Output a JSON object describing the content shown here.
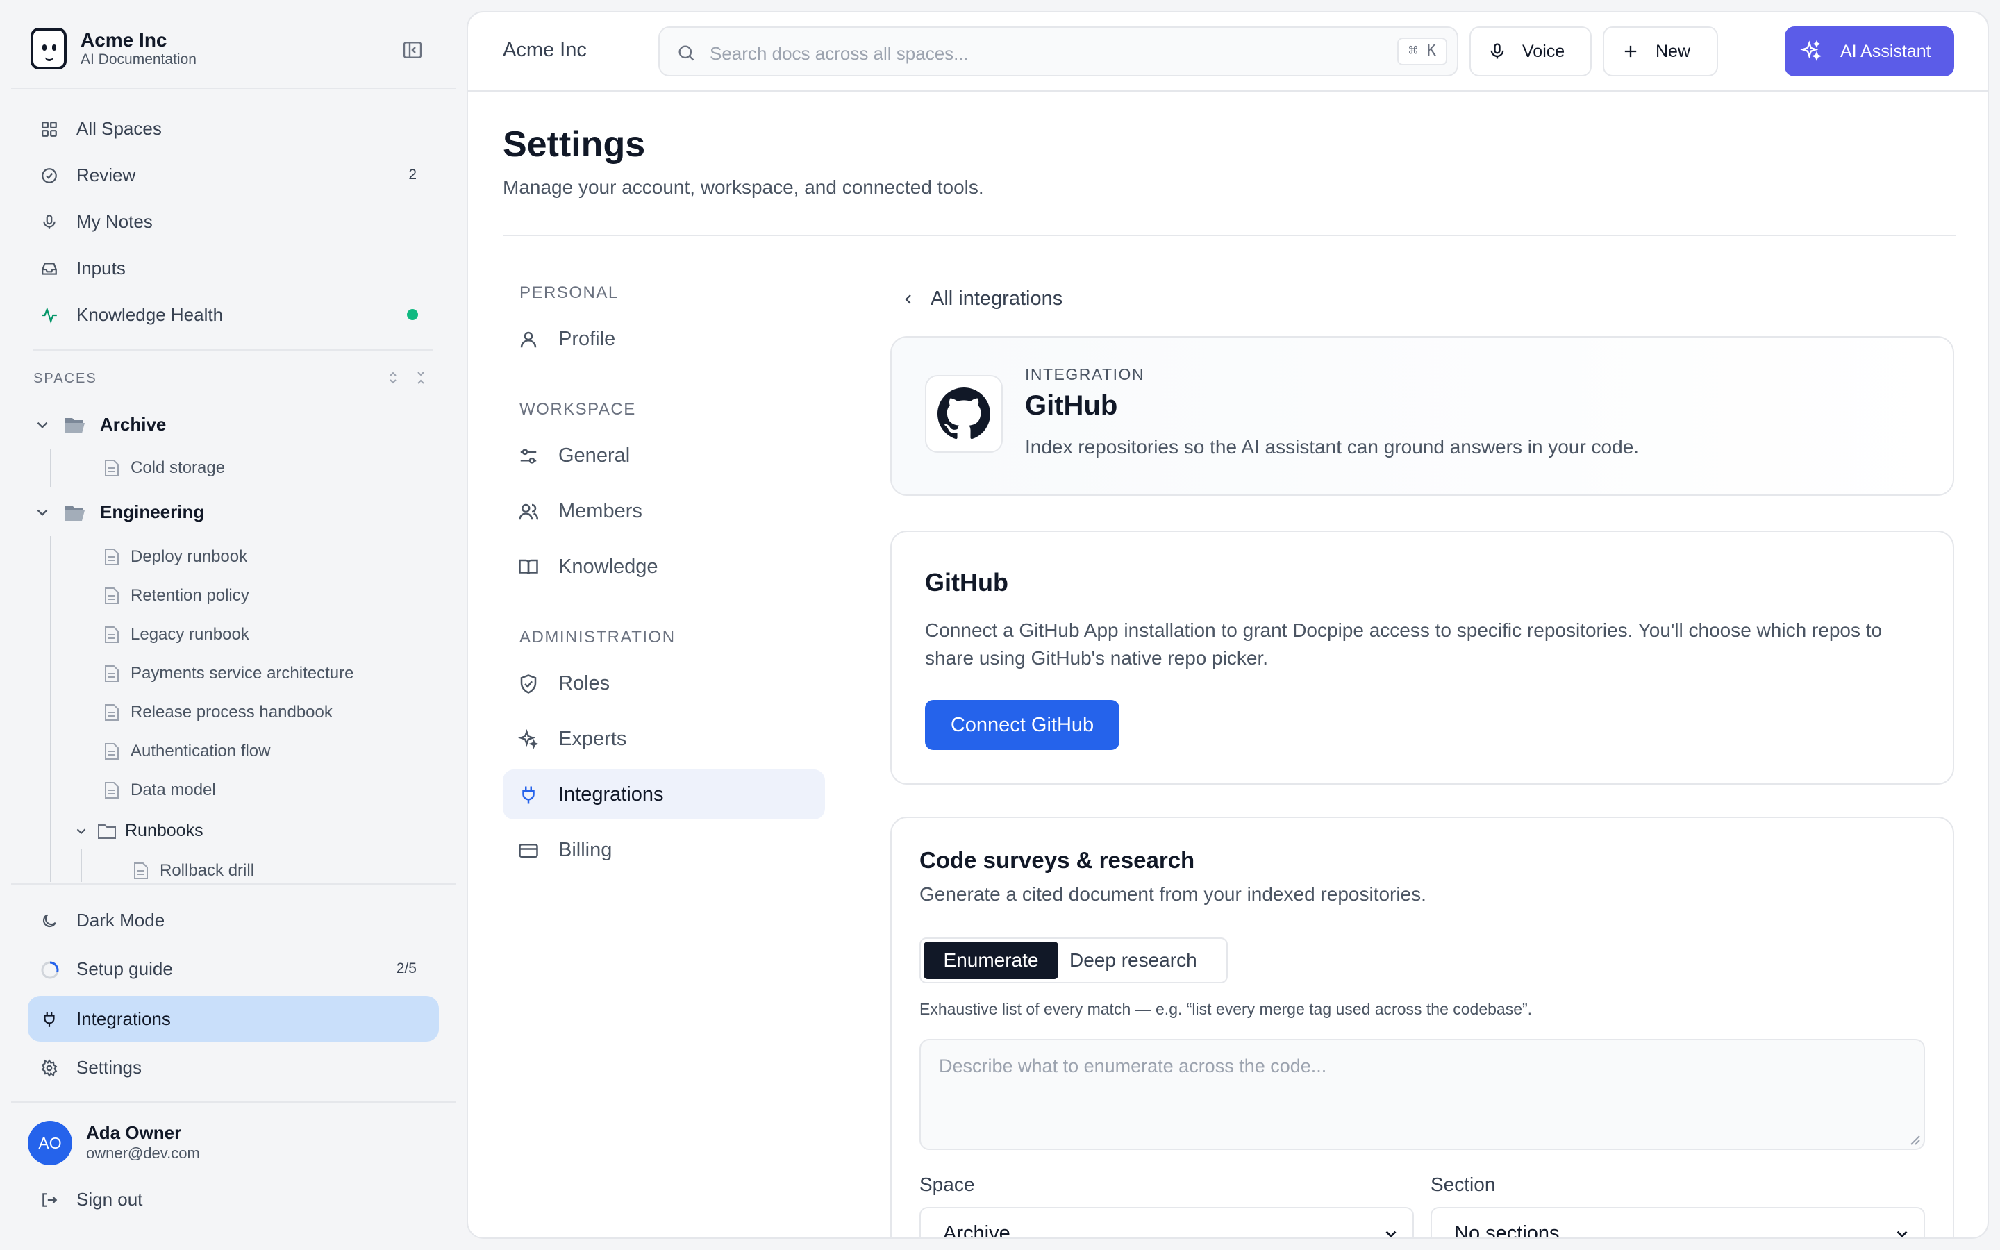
{
  "brand": {
    "name": "Acme Inc",
    "subtitle": "AI Documentation"
  },
  "sidebar": {
    "nav": [
      {
        "label": "All Spaces"
      },
      {
        "label": "Review",
        "count": "2"
      },
      {
        "label": "My Notes"
      },
      {
        "label": "Inputs"
      },
      {
        "label": "Knowledge Health"
      }
    ],
    "spaces_heading": "SPACES",
    "tree": {
      "archive": {
        "label": "Archive",
        "docs": [
          "Cold storage"
        ]
      },
      "engineering": {
        "label": "Engineering",
        "docs": [
          "Deploy runbook",
          "Retention policy",
          "Legacy runbook",
          "Payments service architecture",
          "Release process handbook",
          "Authentication flow",
          "Data model"
        ],
        "subfolder": {
          "label": "Runbooks",
          "docs": [
            "Rollback drill"
          ]
        }
      }
    },
    "bottom": [
      {
        "label": "Dark Mode"
      },
      {
        "label": "Setup guide",
        "count": "2/5"
      },
      {
        "label": "Integrations"
      },
      {
        "label": "Settings"
      }
    ],
    "user": {
      "initials": "AO",
      "name": "Ada Owner",
      "email": "owner@dev.com"
    },
    "signout": "Sign out"
  },
  "topbar": {
    "workspace": "Acme Inc",
    "search_placeholder": "Search docs across all spaces...",
    "shortcut": "⌘ K",
    "voice": "Voice",
    "new": "New",
    "ai": "AI Assistant"
  },
  "page": {
    "title": "Settings",
    "subtitle": "Manage your account, workspace, and connected tools."
  },
  "settings_nav": {
    "personal": {
      "heading": "PERSONAL",
      "items": [
        "Profile"
      ]
    },
    "workspace": {
      "heading": "WORKSPACE",
      "items": [
        "General",
        "Members",
        "Knowledge"
      ]
    },
    "admin": {
      "heading": "ADMINISTRATION",
      "items": [
        "Roles",
        "Experts",
        "Integrations",
        "Billing"
      ]
    }
  },
  "integration": {
    "back": "All integrations",
    "eyebrow": "INTEGRATION",
    "name": "GitHub",
    "description": "Index repositories so the AI assistant can ground answers in your code.",
    "connect_card": {
      "title": "GitHub",
      "body": "Connect a GitHub App installation to grant Docpipe access to specific repositories. You'll choose which repos to share using GitHub's native repo picker.",
      "button": "Connect GitHub"
    },
    "survey": {
      "title": "Code surveys & research",
      "subtitle": "Generate a cited document from your indexed repositories.",
      "tabs": [
        "Enumerate",
        "Deep research"
      ],
      "hint": "Exhaustive list of every match — e.g. “list every merge tag used across the codebase”.",
      "placeholder": "Describe what to enumerate across the code...",
      "space_label": "Space",
      "space_value": "Archive",
      "section_label": "Section",
      "section_value": "No sections"
    }
  },
  "colors": {
    "accent": "#5b5ce8",
    "primary": "#2563eb",
    "active_bg": "#c9dffa",
    "health": "#10b981"
  }
}
